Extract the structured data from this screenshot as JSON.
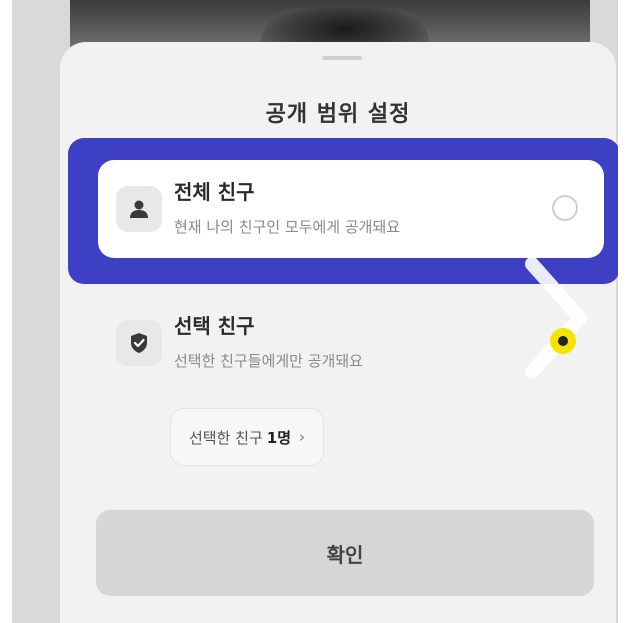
{
  "sheet": {
    "title": "공개 범위 설정",
    "options": [
      {
        "title": "전체 친구",
        "description": "현재 나의 친구인 모두에게 공개돼요",
        "icon": "person-icon",
        "selected": false
      },
      {
        "title": "선택 친구",
        "description": "선택한 친구들에게만 공개돼요",
        "icon": "check-circle-icon",
        "selected": true
      }
    ],
    "selected_friends": {
      "label": "선택한 친구",
      "count": "1명",
      "chevron": "›"
    },
    "confirm_label": "확인"
  },
  "colors": {
    "highlight": "#3d3fc4",
    "selected_radio": "#f4e200",
    "sheet_bg": "#f2f2f2"
  }
}
